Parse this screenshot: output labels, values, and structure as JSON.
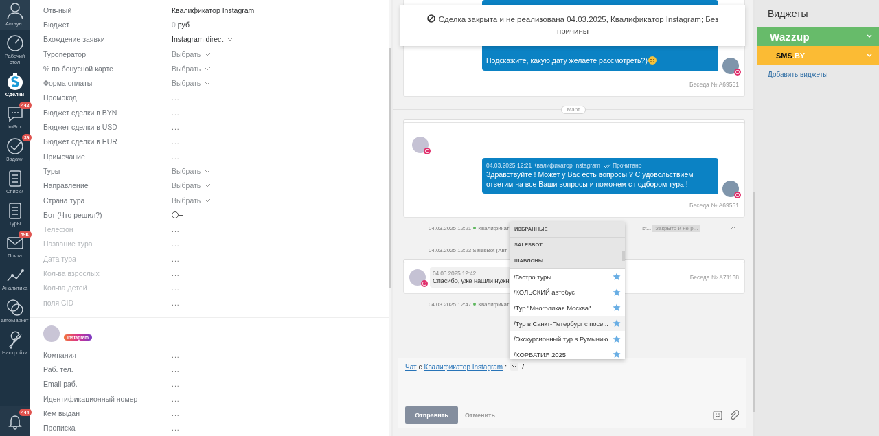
{
  "nav": {
    "items": [
      {
        "label": "Аккаунт",
        "selected": false
      },
      {
        "label": "Рабочий стол",
        "selected": false
      },
      {
        "label": "Сделки",
        "selected": true
      },
      {
        "label": "imBox",
        "badge": "442",
        "selected": false
      },
      {
        "label": "Задачи",
        "badge": "39",
        "selected": false
      },
      {
        "label": "Списки",
        "selected": false
      },
      {
        "label": "Туры",
        "selected": false
      },
      {
        "label": "Почта",
        "badge": "59K",
        "selected": false
      },
      {
        "label": "Аналитика",
        "selected": false
      },
      {
        "label": "amoМаркет",
        "selected": false
      },
      {
        "label": "Настройки",
        "selected": false
      }
    ],
    "bell_badge": "444"
  },
  "deal_fields": [
    {
      "label": "Отв-ный",
      "kind": "text",
      "value": "Квалификатор Instagram",
      "muted": false
    },
    {
      "label": "Бюджет",
      "kind": "money",
      "amount": "0",
      "currency": "руб",
      "muted": false
    },
    {
      "label": "Вхождение заявки",
      "kind": "select",
      "value": "Instagram direct",
      "muted": false
    },
    {
      "label": "Туроператор",
      "kind": "select",
      "placeholder": "Выбрать",
      "muted": false
    },
    {
      "label": "% по бонусной карте",
      "kind": "select",
      "placeholder": "Выбрать",
      "muted": false
    },
    {
      "label": "Форма оплаты",
      "kind": "select",
      "placeholder": "Выбрать",
      "muted": false
    },
    {
      "label": "Промокод",
      "kind": "empty",
      "value": "...",
      "muted": false
    },
    {
      "label": "Бюджет сделки в BYN",
      "kind": "empty",
      "value": "...",
      "muted": false
    },
    {
      "label": "Бюджет сделки в USD",
      "kind": "empty",
      "value": "...",
      "muted": false
    },
    {
      "label": "Бюджет сделки в EUR",
      "kind": "empty",
      "value": "...",
      "muted": false
    },
    {
      "label": "Примечание",
      "kind": "empty",
      "value": "...",
      "muted": false
    },
    {
      "label": "Туры",
      "kind": "select",
      "placeholder": "Выбрать",
      "muted": false
    },
    {
      "label": "Направление",
      "kind": "select",
      "placeholder": "Выбрать",
      "muted": false
    },
    {
      "label": "Страна тура",
      "kind": "select",
      "placeholder": "Выбрать",
      "muted": false
    },
    {
      "label": "Бот (Что решил?)",
      "kind": "toggle",
      "checked": false,
      "muted": false
    },
    {
      "label": "Телефон",
      "kind": "empty",
      "value": "...",
      "muted": true
    },
    {
      "label": "Название тура",
      "kind": "empty",
      "value": "...",
      "muted": true
    },
    {
      "label": "Дата тура",
      "kind": "empty",
      "value": "...",
      "muted": true
    },
    {
      "label": "Кол-ва взрослых",
      "kind": "empty",
      "value": "...",
      "muted": true
    },
    {
      "label": "Кол-ва детей",
      "kind": "empty",
      "value": "...",
      "muted": true
    },
    {
      "label": "поля CID",
      "kind": "empty",
      "value": "...",
      "muted": true
    }
  ],
  "contact": {
    "source": "Instagram",
    "fields": [
      {
        "label": "Компания",
        "value": "..."
      },
      {
        "label": "Раб. тел.",
        "value": "..."
      },
      {
        "label": "Email раб.",
        "value": "..."
      },
      {
        "label": "Идентификационный номер",
        "value": "..."
      },
      {
        "label": "Кем выдан",
        "value": "..."
      },
      {
        "label": "Прописка",
        "value": "..."
      }
    ]
  },
  "feed": {
    "notice": "Сделка закрыта и не реализована 04.03.2025, Квалификатор Instagram; Без причины",
    "items": [
      {
        "kind": "outgoing_card",
        "text": "Подскажите, какую дату желаете рассмотреть?)",
        "emoji": true,
        "footer": "Беседа № A69551"
      },
      {
        "kind": "divider",
        "label": "Март"
      },
      {
        "kind": "outgoing_card",
        "meta": "04.03.2025 12:21 Квалификатор Instagram",
        "status": "Прочитано",
        "text": "Здравствуйте ! Может у Вас есть вопросы ? С удовольствием ответим на все Ваши вопросы и поможем с подбором тура !",
        "footer": "Беседа № A69551"
      },
      {
        "kind": "event",
        "time": "04.03.2025 12:21",
        "online": true,
        "text": "Квалификат",
        "extra": "st...",
        "tag": "Закрыто и не р...",
        "collapsible": true
      },
      {
        "kind": "event",
        "time": "04.03.2025 12:23",
        "online": false,
        "text": "SalesBot (Авт"
      },
      {
        "kind": "incoming_card",
        "meta": "04.03.2025 12:42",
        "text": "Спасибо, уже нашли нужн",
        "footer": "Беседа № A71168"
      },
      {
        "kind": "event",
        "time": "04.03.2025 12:47",
        "online": true,
        "text": "Квалификат"
      }
    ],
    "dropdown": {
      "sections": [
        "ИЗБРАННЫЕ",
        "SALESBOT",
        "ШАБЛОНЫ"
      ],
      "items": [
        {
          "label": "/Гастро туры",
          "hovered": false
        },
        {
          "label": "/КОЛЬСКИЙ автобус",
          "hovered": false
        },
        {
          "label": "/Тур \"Многоликая Москва\"",
          "hovered": false
        },
        {
          "label": "/Тур в Санкт-Петербург с посе...",
          "hovered": true
        },
        {
          "label": "/Экскурсионный тур в Румынию",
          "hovered": false
        },
        {
          "label": "/ХОРВАТИЯ 2025",
          "hovered": false
        }
      ]
    },
    "compose": {
      "chat_link": "Чат",
      "joiner": "с",
      "recipient": "Квалификатор Instagram",
      "colon": ":",
      "value": "/",
      "send": "Отправить",
      "cancel": "Отменить"
    }
  },
  "widgets": {
    "title": "Виджеты",
    "items": [
      {
        "kind": "wazzup",
        "name": "Wazzup",
        "color": "#67bb6a"
      },
      {
        "kind": "smsby",
        "name": "SMS",
        "suffix": ".BY",
        "color": "#fbbb34"
      }
    ],
    "add_link": "Добавить виджеты"
  }
}
